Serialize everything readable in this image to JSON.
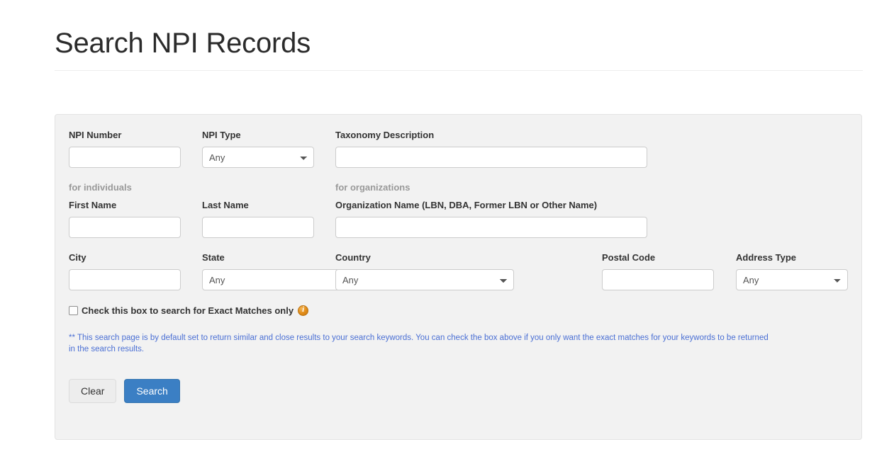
{
  "header": {
    "title": "Search NPI Records"
  },
  "form": {
    "row1": {
      "npi_number": {
        "label": "NPI Number",
        "value": "",
        "placeholder": ""
      },
      "npi_type": {
        "label": "NPI Type",
        "selected": "Any",
        "options": [
          "Any"
        ]
      },
      "taxonomy_description": {
        "label": "Taxonomy Description",
        "value": "",
        "placeholder": ""
      }
    },
    "group_labels": {
      "individuals": "for individuals",
      "organizations": "for organizations"
    },
    "row2": {
      "first_name": {
        "label": "First Name",
        "value": "",
        "placeholder": ""
      },
      "last_name": {
        "label": "Last Name",
        "value": "",
        "placeholder": ""
      },
      "organization_name": {
        "label": "Organization Name (LBN, DBA, Former LBN or Other Name)",
        "value": "",
        "placeholder": ""
      }
    },
    "row3": {
      "city": {
        "label": "City",
        "value": "",
        "placeholder": ""
      },
      "state": {
        "label": "State",
        "selected": "Any",
        "options": [
          "Any"
        ]
      },
      "country": {
        "label": "Country",
        "selected": "Any",
        "options": [
          "Any"
        ]
      },
      "postal_code": {
        "label": "Postal Code",
        "value": "",
        "placeholder": ""
      },
      "address_type": {
        "label": "Address Type",
        "selected": "Any",
        "options": [
          "Any"
        ]
      }
    },
    "exact_match": {
      "label": "Check this box to search for Exact Matches only",
      "checked": false,
      "info_icon": "info-icon"
    },
    "help_note": "** This search page is by default set to return similar and close results to your search keywords. You can check the box above if you only want the exact matches for your keywords to be returned in the search results.",
    "buttons": {
      "clear": "Clear",
      "search": "Search"
    }
  },
  "colors": {
    "accent_blue": "#3b7fc4",
    "help_text_blue": "#4a6fd4",
    "panel_bg": "#f2f2f2",
    "panel_border": "#e3e3e3",
    "info_icon_orange": "#e08b17",
    "muted_label": "#999999"
  }
}
